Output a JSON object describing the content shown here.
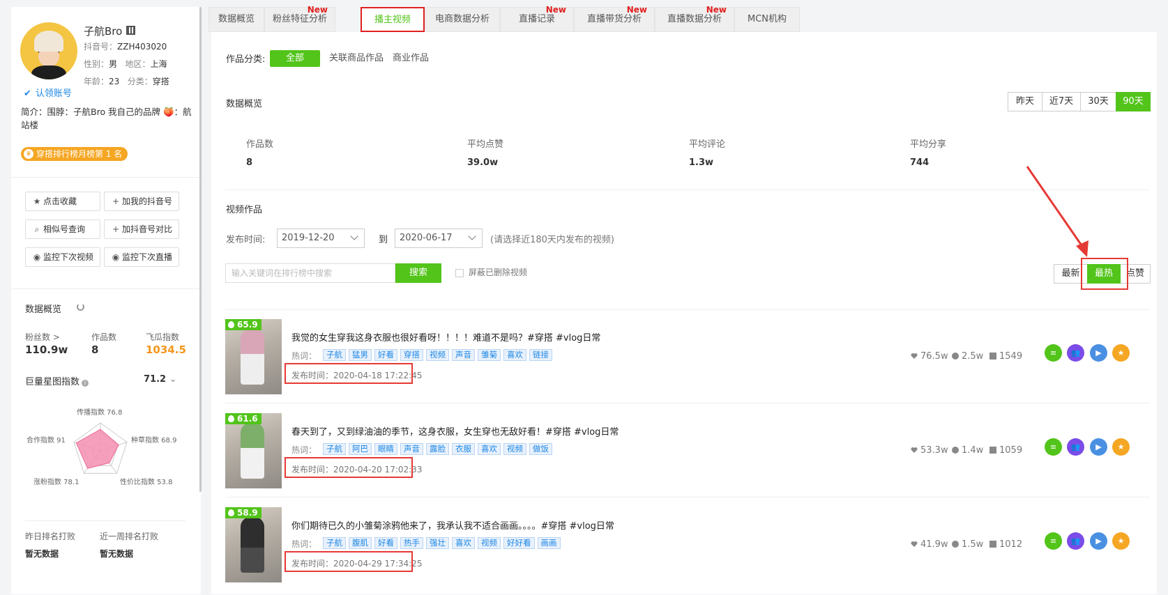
{
  "profile": {
    "name": "子航Bro",
    "douyin_label": "抖音号：",
    "douyin_id": "ZZH403020",
    "gender_label": "性别：",
    "gender": "男",
    "region_label": "地区：",
    "region": "上海",
    "age_label": "年龄：",
    "age": "23",
    "category_label": "分类：",
    "category": "穿搭",
    "claim": "认领账号",
    "intro": "简介：围脖：子航Bro 我自己的品牌 🍑：航站楼",
    "rank_badge": "穿搭排行榜月榜第 1 名"
  },
  "actions": {
    "collect": "点击收藏",
    "add_my": "加我的抖音号",
    "similar": "相似号查询",
    "compare": "加抖音号对比",
    "monitor_video": "监控下次视频",
    "monitor_live": "监控下次直播"
  },
  "overview": {
    "title": "数据概览",
    "fans_label": "粉丝数 >",
    "fans": "110.9w",
    "works_label": "作品数",
    "works": "8",
    "feigua_label": "飞瓜指数",
    "feigua": "1034.5",
    "juliang_label": "巨量星图指数",
    "juliang": "71.2",
    "radar": {
      "labels": [
        "传播指数 76.8",
        "种草指数 68.9",
        "性价比指数 53.8",
        "涨粉指数 78.1",
        "合作指数 91"
      ],
      "values": [
        76.8,
        68.9,
        53.8,
        78.1,
        91
      ]
    },
    "yesterday_label": "昨日排名打败",
    "yesterday": "暂无数据",
    "week_label": "近一周排名打败",
    "week": "暂无数据"
  },
  "tabs": [
    {
      "label": "数据概览",
      "new": ""
    },
    {
      "label": "粉丝特征分析",
      "new": "New"
    },
    {
      "label": "播主视频",
      "new": ""
    },
    {
      "label": "电商数据分析",
      "new": ""
    },
    {
      "label": "直播记录",
      "new": "New"
    },
    {
      "label": "直播带货分析",
      "new": "New"
    },
    {
      "label": "直播数据分析",
      "new": "New"
    },
    {
      "label": "MCN机构",
      "new": ""
    }
  ],
  "filter": {
    "category_label": "作品分类:",
    "all": "全部",
    "related": "关联商品作品",
    "commercial": "商业作品"
  },
  "summary": {
    "title": "数据概览",
    "ranges": [
      "昨天",
      "近7天",
      "30天",
      "90天"
    ],
    "active_range": "90天",
    "kpis": [
      {
        "label": "作品数",
        "value": "8"
      },
      {
        "label": "平均点赞",
        "value": "39.0w"
      },
      {
        "label": "平均评论",
        "value": "1.3w"
      },
      {
        "label": "平均分享",
        "value": "744"
      }
    ]
  },
  "videos_section": {
    "title": "视频作品",
    "publish_label": "发布时间:",
    "date_from": "2019-12-20",
    "to_label": "到",
    "date_to": "2020-06-17",
    "date_hint": "(请选择近180天内发布的视频)",
    "search_placeholder": "输入关键词在排行榜中搜索",
    "search_btn": "搜索",
    "hide_deleted": "屏蔽已删除视频",
    "sort": [
      "最新",
      "最热",
      "点赞"
    ],
    "active_sort": "最热"
  },
  "videos": [
    {
      "score": "65.9",
      "title": "我觉的女生穿我这身衣服也很好看呀！！！！难道不是吗？#穿搭 #vlog日常",
      "hot_label": "热词：",
      "tags": [
        "子航",
        "猛男",
        "好看",
        "穿搭",
        "视频",
        "声音",
        "雏菊",
        "喜欢",
        "链接"
      ],
      "publish": "发布时间：2020-04-18 17:22:45",
      "likes": "76.5w",
      "comments": "2.5w",
      "shares": "1549"
    },
    {
      "score": "61.6",
      "title": "春天到了，又到绿油油的季节，这身衣服，女生穿也无敌好看！#穿搭 #vlog日常",
      "hot_label": "热词：",
      "tags": [
        "子航",
        "阿巴",
        "眼睛",
        "声音",
        "露脸",
        "衣服",
        "喜欢",
        "视频",
        "做饭"
      ],
      "publish": "发布时间：2020-04-20 17:02:33",
      "likes": "53.3w",
      "comments": "1.4w",
      "shares": "1059"
    },
    {
      "score": "58.9",
      "title": "你们期待已久的小雏菊涂鸦他来了，我承认我不适合画画。。。。#穿搭 #vlog日常",
      "hot_label": "热词：",
      "tags": [
        "子航",
        "腹肌",
        "好看",
        "热手",
        "强壮",
        "喜欢",
        "视频",
        "好好看",
        "画画"
      ],
      "publish": "发布时间：2020-04-29 17:34:25",
      "likes": "41.9w",
      "comments": "1.5w",
      "shares": "1012"
    }
  ],
  "colors": {
    "accent": "#52c41a",
    "highlight": "#e53935",
    "link": "#1e88e5",
    "orange": "#f5961e"
  }
}
